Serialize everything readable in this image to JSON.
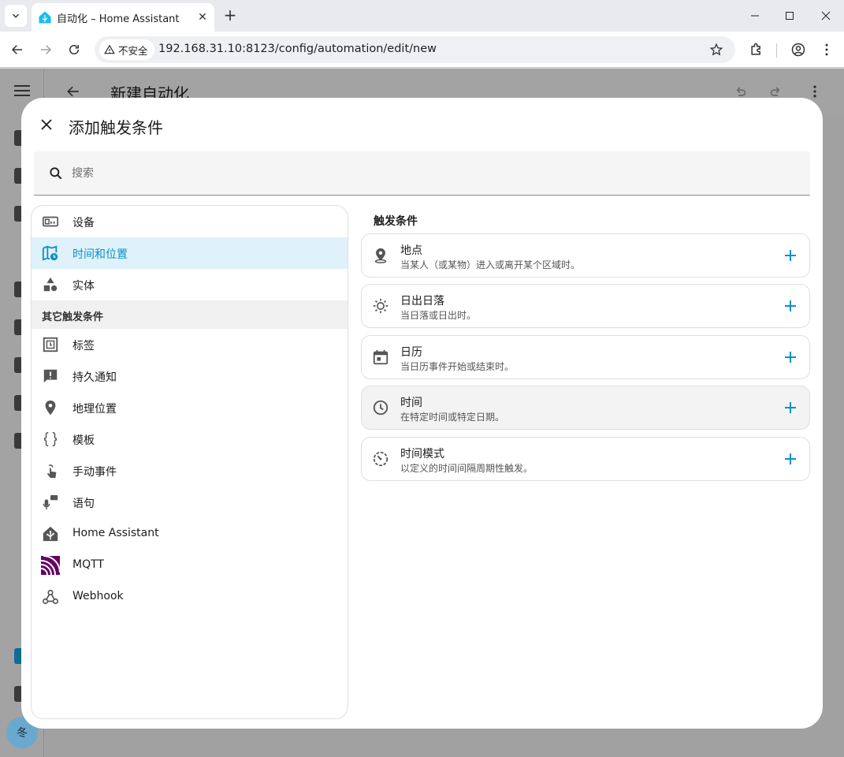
{
  "browser": {
    "tab_title": "自动化 – Home Assistant",
    "security_label": "不安全",
    "url": "192.168.31.10:8123/config/automation/edit/new"
  },
  "app": {
    "page_title": "新建自动化",
    "avatar_text": "冬"
  },
  "dialog": {
    "title": "添加触发条件",
    "search_placeholder": "搜索",
    "categories": [
      {
        "label": "设备",
        "icon": "device-icon",
        "active": false
      },
      {
        "label": "时间和位置",
        "icon": "map-clock-icon",
        "active": true
      },
      {
        "label": "实体",
        "icon": "shapes-icon",
        "active": false
      }
    ],
    "other_header": "其它触发条件",
    "other": [
      {
        "label": "标签",
        "icon": "tag-nfc-icon"
      },
      {
        "label": "持久通知",
        "icon": "message-alert-icon"
      },
      {
        "label": "地理位置",
        "icon": "map-marker-icon"
      },
      {
        "label": "模板",
        "icon": "code-braces-icon"
      },
      {
        "label": "手动事件",
        "icon": "gesture-tap-icon"
      },
      {
        "label": "语句",
        "icon": "microphone-message-icon"
      },
      {
        "label": "Home Assistant",
        "icon": "home-assistant-icon"
      },
      {
        "label": "MQTT",
        "icon": "mqtt-icon"
      },
      {
        "label": "Webhook",
        "icon": "webhook-icon"
      }
    ],
    "right_title": "触发条件",
    "triggers": [
      {
        "title": "地点",
        "desc": "当某人（或某物）进入或离开某个区域时。",
        "icon": "map-marker-radius-icon"
      },
      {
        "title": "日出日落",
        "desc": "当日落或日出时。",
        "icon": "weather-sunny-icon"
      },
      {
        "title": "日历",
        "desc": "当日历事件开始或结束时。",
        "icon": "calendar-icon"
      },
      {
        "title": "时间",
        "desc": "在特定时间或特定日期。",
        "icon": "clock-outline-icon"
      },
      {
        "title": "时间模式",
        "desc": "以定义的时间间隔周期性触发。",
        "icon": "timer-outline-icon"
      }
    ]
  },
  "colors": {
    "accent": "#0b91c5",
    "active_bg": "#dff1fa",
    "mqtt": "#660066"
  }
}
